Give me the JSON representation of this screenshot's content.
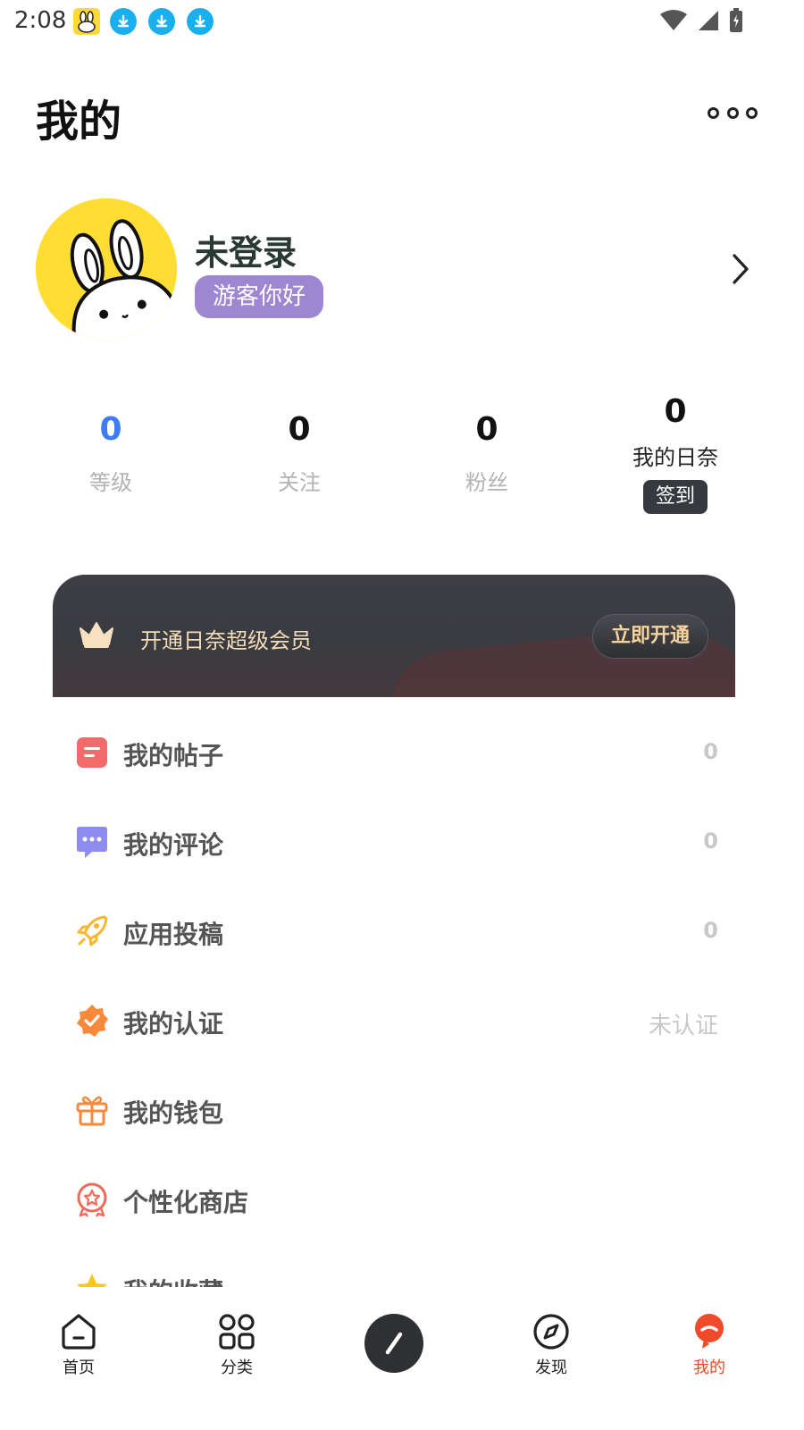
{
  "status_bar": {
    "time": "2:08",
    "icons": [
      "bunny-app-icon",
      "download-icon",
      "download-icon",
      "download-icon",
      "wifi-icon",
      "signal-icon",
      "battery-charging-icon"
    ]
  },
  "header": {
    "title": "我的",
    "more_icon": "more-dots-icon"
  },
  "profile": {
    "name": "未登录",
    "badge": "游客你好",
    "chevron_icon": "chevron-right-icon"
  },
  "stats": [
    {
      "value": "0",
      "label": "等级"
    },
    {
      "value": "0",
      "label": "关注"
    },
    {
      "value": "0",
      "label": "粉丝"
    }
  ],
  "checkin": {
    "value": "0",
    "label": "我的日奈",
    "button": "签到"
  },
  "vip": {
    "text": "开通日奈超级会员",
    "button": "立即开通",
    "icon": "crown-icon"
  },
  "menu": [
    {
      "label": "我的帖子",
      "value": "0",
      "icon": "post-icon",
      "color": "#f26a6a"
    },
    {
      "label": "我的评论",
      "value": "0",
      "icon": "comment-icon",
      "color": "#8f8cf0"
    },
    {
      "label": "应用投稿",
      "value": "0",
      "icon": "rocket-icon",
      "color": "#f6b62e"
    },
    {
      "label": "我的认证",
      "value": "未认证",
      "icon": "verified-icon",
      "color": "#f9893a"
    },
    {
      "label": "我的钱包",
      "value": "",
      "icon": "gift-icon",
      "color": "#f7893a"
    },
    {
      "label": "个性化商店",
      "value": "",
      "icon": "badge-icon",
      "color": "#f06a5a"
    },
    {
      "label": "我的收藏",
      "value": "",
      "icon": "star-icon",
      "color": "#ffc61a"
    }
  ],
  "nav": [
    {
      "label": "首页",
      "icon": "home-icon"
    },
    {
      "label": "分类",
      "icon": "category-icon"
    },
    {
      "label": "",
      "icon": "compose-icon"
    },
    {
      "label": "发现",
      "icon": "compass-icon"
    },
    {
      "label": "我的",
      "icon": "profile-icon",
      "active": true
    }
  ],
  "colors": {
    "accent_blue": "#3d7cf5",
    "badge_purple": "#9f86d0",
    "active_nav": "#f04a2a",
    "vip_gold": "#f4d39c"
  }
}
